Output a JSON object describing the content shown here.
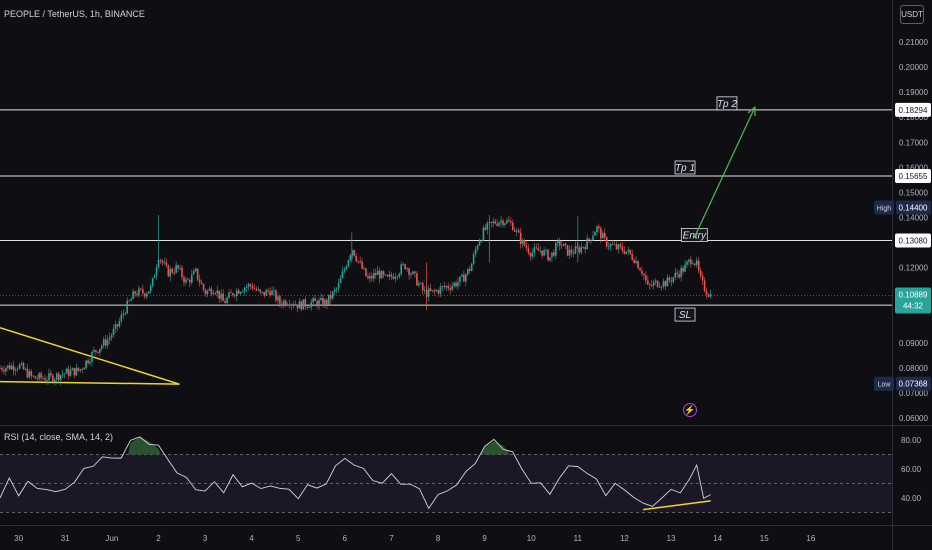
{
  "header": {
    "title": "PEOPLE / TetherUS, 1h, BINANCE",
    "currency": "USDT"
  },
  "rsi_header": "RSI (14, close, SMA, 14, 2)",
  "price_labels": {
    "current": "0.10889",
    "countdown": "44:32",
    "high_tag": "High",
    "high": "0.14400",
    "low_tag": "Low",
    "low": "0.07368"
  },
  "colors": {
    "background": "#0f0f13",
    "up": "#26a69a",
    "down": "#ef5350",
    "trendline": "#f0d52f",
    "projection": "#4caf50",
    "rsi_line": "#d6d6d6",
    "rsi_band": "#1c1726"
  },
  "chart_data": [
    {
      "type": "candlestick",
      "title": "PEOPLE / TetherUS, 1h, BINANCE",
      "x_ticks": [
        "30",
        "31",
        "Jun",
        "2",
        "3",
        "4",
        "5",
        "6",
        "7",
        "8",
        "9",
        "10",
        "11",
        "12",
        "13",
        "14",
        "15",
        "16"
      ],
      "y_ticks": [
        "0.21000",
        "0.20000",
        "0.19000",
        "0.18000",
        "0.17000",
        "0.16000",
        "0.15000",
        "0.14000",
        "0.12000",
        "0.09000",
        "0.08000",
        "0.07000",
        "0.06000"
      ],
      "ylim": [
        0.058,
        0.22
      ],
      "levels": [
        {
          "name": "Tp 2",
          "value": 0.18294,
          "label": "0.18294"
        },
        {
          "name": "Tp 1",
          "value": 0.15655,
          "label": "0.15655"
        },
        {
          "name": "Entry",
          "value": 0.1308,
          "label": "0.13080"
        },
        {
          "name": "SL",
          "value": 0.10505,
          "label": "0.10505"
        }
      ],
      "close_path": [
        [
          29.6,
          0.08
        ],
        [
          30.0,
          0.081
        ],
        [
          30.3,
          0.076
        ],
        [
          30.7,
          0.076
        ],
        [
          31.0,
          0.078
        ],
        [
          31.3,
          0.079
        ],
        [
          31.6,
          0.086
        ],
        [
          31.9,
          0.091
        ],
        [
          32.1,
          0.096
        ],
        [
          32.3,
          0.104
        ],
        [
          32.5,
          0.11
        ],
        [
          32.7,
          0.11
        ],
        [
          32.85,
          0.112
        ],
        [
          33.0,
          0.125
        ],
        [
          33.2,
          0.118
        ],
        [
          33.4,
          0.12
        ],
        [
          33.6,
          0.114
        ],
        [
          33.8,
          0.118
        ],
        [
          34.0,
          0.11
        ],
        [
          34.2,
          0.112
        ],
        [
          34.4,
          0.106
        ],
        [
          34.6,
          0.11
        ],
        [
          34.8,
          0.112
        ],
        [
          35.0,
          0.113
        ],
        [
          35.2,
          0.109
        ],
        [
          35.4,
          0.111
        ],
        [
          35.6,
          0.106
        ],
        [
          35.8,
          0.107
        ],
        [
          36.0,
          0.105
        ],
        [
          36.3,
          0.106
        ],
        [
          36.6,
          0.106
        ],
        [
          36.85,
          0.112
        ],
        [
          37.0,
          0.12
        ],
        [
          37.15,
          0.128
        ],
        [
          37.3,
          0.122
        ],
        [
          37.5,
          0.115
        ],
        [
          37.7,
          0.118
        ],
        [
          37.9,
          0.115
        ],
        [
          38.1,
          0.118
        ],
        [
          38.3,
          0.121
        ],
        [
          38.5,
          0.116
        ],
        [
          38.7,
          0.11
        ],
        [
          38.9,
          0.11
        ],
        [
          39.1,
          0.112
        ],
        [
          39.3,
          0.113
        ],
        [
          39.5,
          0.115
        ],
        [
          39.7,
          0.12
        ],
        [
          39.85,
          0.13
        ],
        [
          40.0,
          0.135
        ],
        [
          40.2,
          0.138
        ],
        [
          40.4,
          0.139
        ],
        [
          40.6,
          0.137
        ],
        [
          40.8,
          0.13
        ],
        [
          41.0,
          0.126
        ],
        [
          41.2,
          0.127
        ],
        [
          41.4,
          0.124
        ],
        [
          41.6,
          0.13
        ],
        [
          41.8,
          0.126
        ],
        [
          42.0,
          0.127
        ],
        [
          42.2,
          0.13
        ],
        [
          42.4,
          0.136
        ],
        [
          42.6,
          0.13
        ],
        [
          42.8,
          0.128
        ],
        [
          43.0,
          0.127
        ],
        [
          43.2,
          0.124
        ],
        [
          43.4,
          0.118
        ],
        [
          43.5,
          0.112
        ],
        [
          43.7,
          0.114
        ],
        [
          43.9,
          0.114
        ],
        [
          44.1,
          0.117
        ],
        [
          44.3,
          0.12
        ],
        [
          44.45,
          0.124
        ],
        [
          44.55,
          0.121
        ],
        [
          44.65,
          0.114
        ],
        [
          44.75,
          0.111
        ],
        [
          44.85,
          0.109
        ]
      ],
      "trendlines": [
        {
          "name": "descending",
          "points": [
            [
              29.6,
              0.096
            ],
            [
              33.45,
              0.0735
            ]
          ]
        },
        {
          "name": "support",
          "points": [
            [
              29.6,
              0.0745
            ],
            [
              33.45,
              0.0735
            ]
          ]
        }
      ],
      "projection": {
        "from": [
          44.5,
          0.132
        ],
        "to": [
          45.8,
          0.184
        ]
      },
      "annotations": [
        "Tp 2",
        "Tp 1",
        "Entry",
        "SL"
      ]
    },
    {
      "type": "line",
      "title": "RSI (14, close, SMA, 14, 2)",
      "y_ticks": [
        "80.00",
        "60.00",
        "40.00"
      ],
      "ylim": [
        22,
        88
      ],
      "bands": [
        30,
        50,
        70
      ],
      "values": [
        [
          29.6,
          40
        ],
        [
          29.8,
          52
        ],
        [
          30.0,
          44
        ],
        [
          30.2,
          50
        ],
        [
          30.4,
          46
        ],
        [
          30.6,
          48
        ],
        [
          30.8,
          42
        ],
        [
          31.0,
          47
        ],
        [
          31.2,
          52
        ],
        [
          31.4,
          58
        ],
        [
          31.6,
          64
        ],
        [
          31.8,
          68
        ],
        [
          32.0,
          66
        ],
        [
          32.2,
          70
        ],
        [
          32.4,
          78
        ],
        [
          32.6,
          82
        ],
        [
          32.8,
          79
        ],
        [
          33.0,
          74
        ],
        [
          33.2,
          68
        ],
        [
          33.4,
          58
        ],
        [
          33.6,
          52
        ],
        [
          33.8,
          48
        ],
        [
          34.0,
          44
        ],
        [
          34.2,
          50
        ],
        [
          34.4,
          46
        ],
        [
          34.6,
          54
        ],
        [
          34.8,
          48
        ],
        [
          35.0,
          52
        ],
        [
          35.2,
          44
        ],
        [
          35.4,
          50
        ],
        [
          35.6,
          47
        ],
        [
          35.8,
          44
        ],
        [
          36.0,
          42
        ],
        [
          36.2,
          48
        ],
        [
          36.4,
          46
        ],
        [
          36.6,
          52
        ],
        [
          36.8,
          60
        ],
        [
          37.0,
          68
        ],
        [
          37.2,
          64
        ],
        [
          37.4,
          58
        ],
        [
          37.6,
          54
        ],
        [
          37.8,
          50
        ],
        [
          38.0,
          55
        ],
        [
          38.2,
          52
        ],
        [
          38.4,
          48
        ],
        [
          38.6,
          46
        ],
        [
          38.8,
          35
        ],
        [
          39.0,
          40
        ],
        [
          39.2,
          46
        ],
        [
          39.4,
          50
        ],
        [
          39.6,
          56
        ],
        [
          39.8,
          66
        ],
        [
          40.0,
          75
        ],
        [
          40.2,
          79
        ],
        [
          40.4,
          76
        ],
        [
          40.6,
          70
        ],
        [
          40.8,
          60
        ],
        [
          41.0,
          52
        ],
        [
          41.2,
          48
        ],
        [
          41.4,
          44
        ],
        [
          41.6,
          54
        ],
        [
          41.8,
          60
        ],
        [
          42.0,
          64
        ],
        [
          42.2,
          56
        ],
        [
          42.4,
          52
        ],
        [
          42.6,
          44
        ],
        [
          42.8,
          48
        ],
        [
          43.0,
          46
        ],
        [
          43.2,
          42
        ],
        [
          43.4,
          34
        ],
        [
          43.6,
          36
        ],
        [
          43.8,
          40
        ],
        [
          44.0,
          44
        ],
        [
          44.2,
          46
        ],
        [
          44.4,
          52
        ],
        [
          44.55,
          62
        ],
        [
          44.7,
          42
        ],
        [
          44.85,
          40
        ]
      ],
      "divergence_line": {
        "points": [
          [
            43.4,
            32
          ],
          [
            44.85,
            38
          ]
        ]
      }
    }
  ]
}
